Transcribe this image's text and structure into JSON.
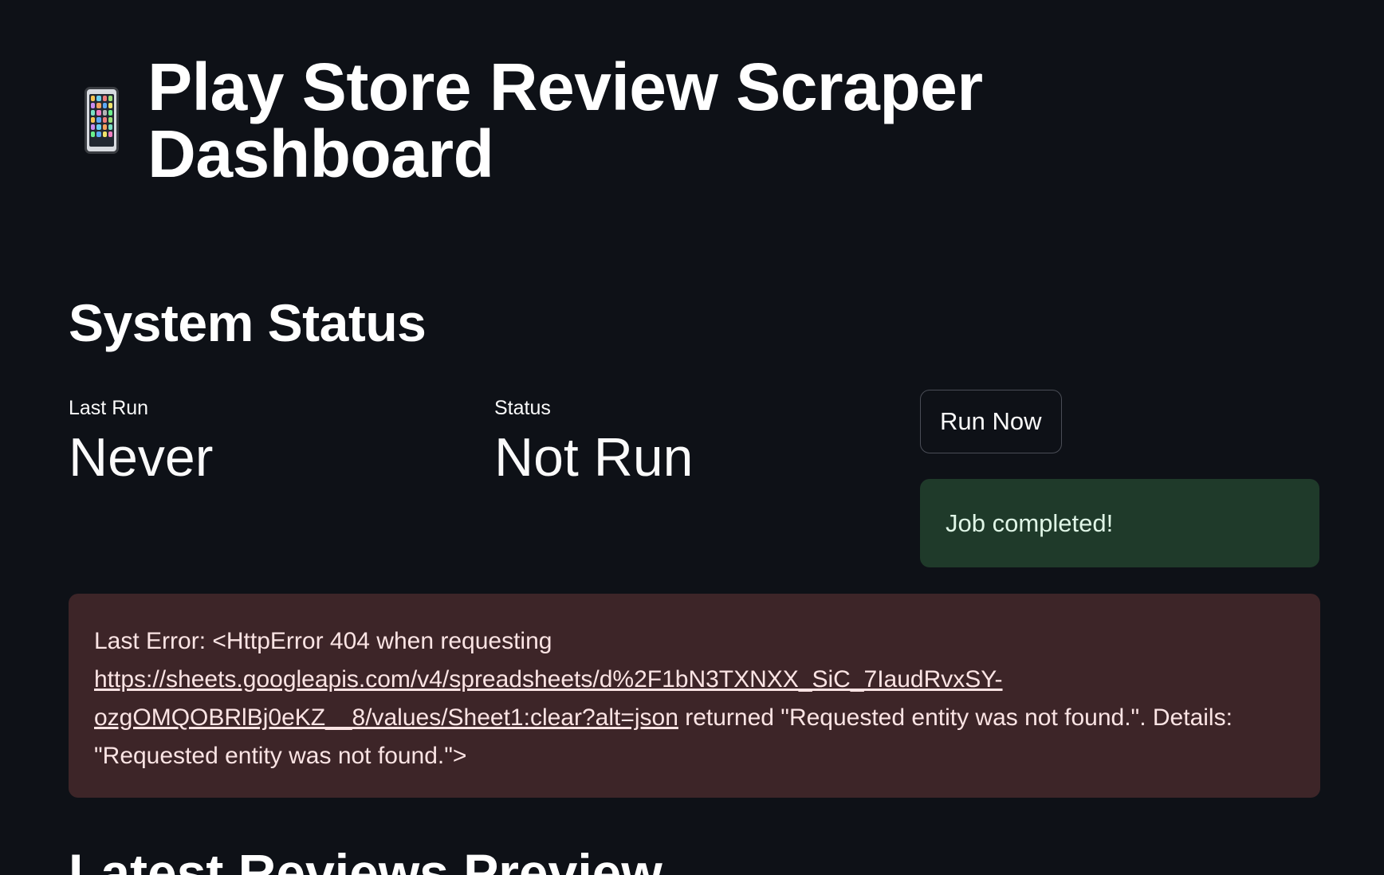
{
  "header": {
    "icon": "mobile-phone-icon",
    "title": "Play Store Review Scraper Dashboard"
  },
  "system_status": {
    "heading": "System Status",
    "last_run": {
      "label": "Last Run",
      "value": "Never"
    },
    "status": {
      "label": "Status",
      "value": "Not Run"
    },
    "run_button_label": "Run Now",
    "success_message": "Job completed!"
  },
  "error": {
    "prefix": "Last Error: <HttpError 404 when requesting ",
    "link_text_line1": "https://sheets.googleapis.com/v4/spreadsheets/d%2F1bN3TXNXX_SiC_7IaudRvxSY-",
    "link_text_line2": "ozgOMQOBRlBj0eKZ__8/values/Sheet1:clear?alt=json",
    "suffix": " returned \"Requested entity was not found.\". Details: \"Requested entity was not found.\">"
  },
  "next_section": {
    "heading": "Latest Reviews Preview"
  },
  "colors": {
    "background": "#0e1117",
    "success_bg": "#1f3a2a",
    "error_bg": "#3d2528"
  }
}
